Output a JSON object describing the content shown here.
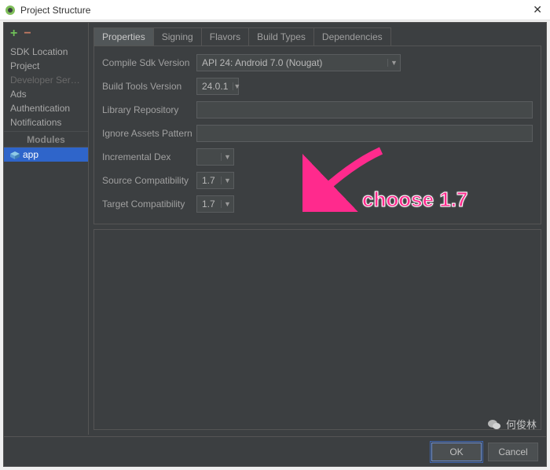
{
  "window": {
    "title": "Project Structure"
  },
  "sidebar": {
    "items": [
      {
        "label": "SDK Location",
        "dim": false
      },
      {
        "label": "Project",
        "dim": false
      },
      {
        "label": "Developer Servic...",
        "dim": true
      },
      {
        "label": "Ads",
        "dim": false
      },
      {
        "label": "Authentication",
        "dim": false
      },
      {
        "label": "Notifications",
        "dim": false
      }
    ],
    "modules_header": "Modules",
    "selected_module": "app"
  },
  "tabs": [
    {
      "label": "Properties",
      "active": true
    },
    {
      "label": "Signing",
      "active": false
    },
    {
      "label": "Flavors",
      "active": false
    },
    {
      "label": "Build Types",
      "active": false
    },
    {
      "label": "Dependencies",
      "active": false
    }
  ],
  "form": {
    "compile_sdk": {
      "label": "Compile Sdk Version",
      "value": "API 24: Android 7.0 (Nougat)"
    },
    "build_tools": {
      "label": "Build Tools Version",
      "value": "24.0.1"
    },
    "library_repo": {
      "label": "Library Repository",
      "value": ""
    },
    "ignore_assets": {
      "label": "Ignore Assets Pattern",
      "value": ""
    },
    "incremental_dex": {
      "label": "Incremental Dex",
      "value": ""
    },
    "source_compat": {
      "label": "Source Compatibility",
      "value": "1.7"
    },
    "target_compat": {
      "label": "Target Compatibility",
      "value": "1.7"
    }
  },
  "buttons": {
    "ok": "OK",
    "cancel": "Cancel"
  },
  "annotation": {
    "text": "choose 1.7"
  },
  "watermark": {
    "text": "何俊林"
  }
}
